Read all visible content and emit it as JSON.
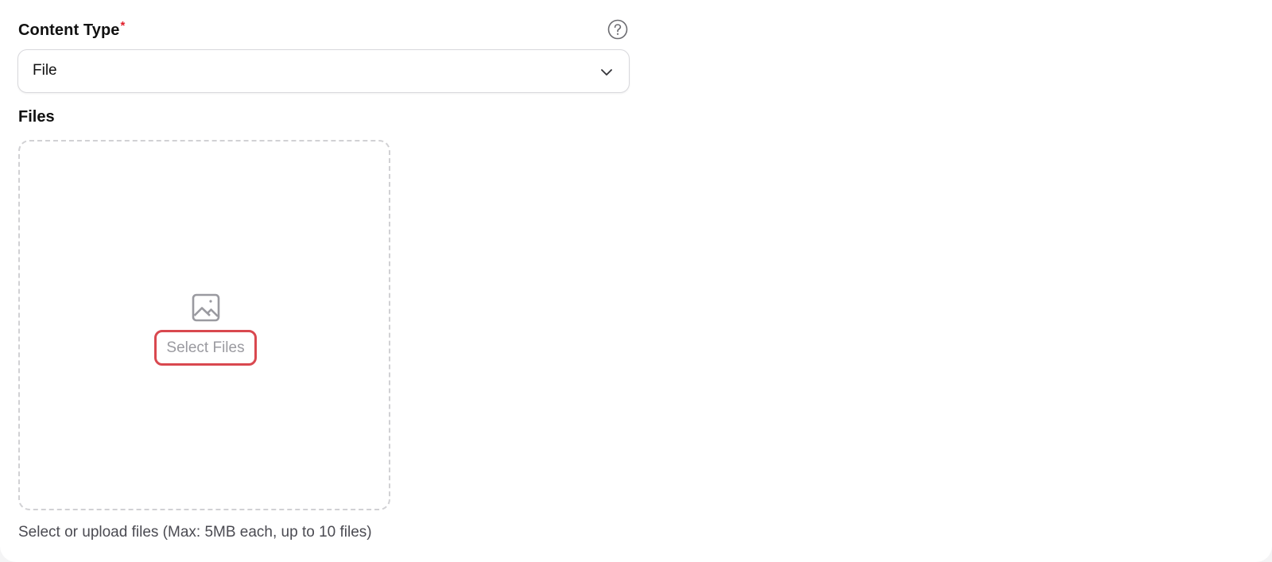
{
  "content_type": {
    "label": "Content Type",
    "required_marker": "*",
    "help_icon": "question-circle-icon",
    "selected_value": "File",
    "dropdown_icon": "chevron-down-icon"
  },
  "files": {
    "label": "Files",
    "dropzone_icon": "image-icon",
    "button_label": "Select Files",
    "helper_text": "Select or upload files (Max: 5MB each, up to 10 files)"
  },
  "colors": {
    "required": "#e11d2a",
    "button_highlight_border": "#d9484f",
    "dashed_border": "#d1d1d4",
    "muted_text": "#9a9aa0"
  }
}
